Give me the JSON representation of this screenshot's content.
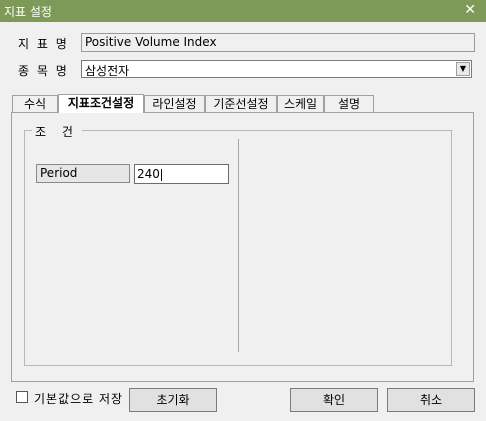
{
  "window": {
    "title": "지표 설정",
    "close_glyph": "✕"
  },
  "form": {
    "indicator_label": "지 표 명",
    "indicator_value": "Positive Volume Index",
    "stock_label": "종 목 명",
    "stock_value": "삼성전자",
    "dropdown_glyph": "▼"
  },
  "tabs": [
    {
      "label": "수식",
      "active": false
    },
    {
      "label": "지표조건설정",
      "active": true
    },
    {
      "label": "라인설정",
      "active": false
    },
    {
      "label": "기준선설정",
      "active": false
    },
    {
      "label": "스케일",
      "active": false
    },
    {
      "label": "설명",
      "active": false
    }
  ],
  "conditions": {
    "group_title": "조 건",
    "param_label": "Period",
    "param_value": "240"
  },
  "footer": {
    "checkbox_label": "기본값으로 저장",
    "checkbox_checked": false,
    "reset_button": "초기화",
    "ok_button": "확인",
    "cancel_button": "취소"
  }
}
